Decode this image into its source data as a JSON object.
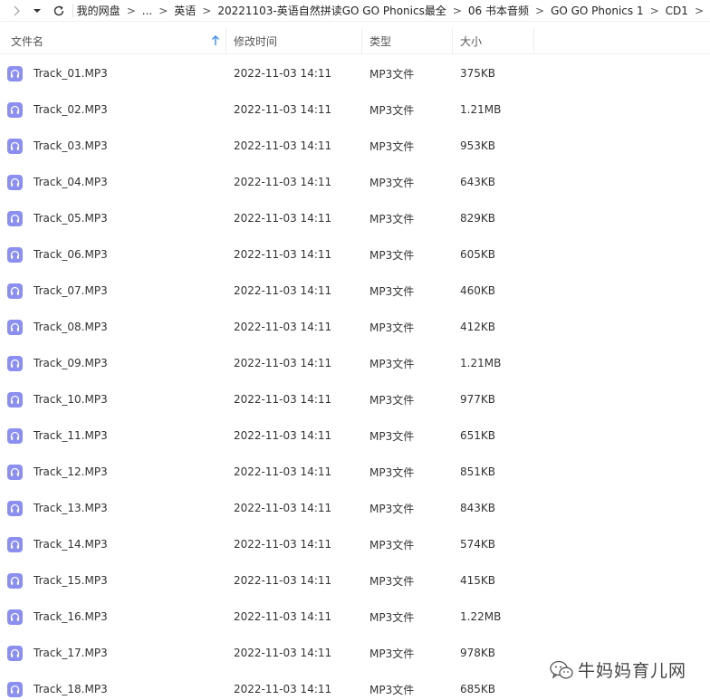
{
  "navbar": {
    "back_icon": "chevron-right-icon",
    "menu_icon": "chevron-down-icon",
    "refresh_icon": "refresh-icon",
    "crumbs": [
      "我的网盘",
      "...",
      "英语",
      "20221103-英语自然拼读GO GO Phonics最全",
      "06 书本音频",
      "GO GO Phonics 1",
      "CD1"
    ],
    "separator": ">"
  },
  "columns": {
    "name": "文件名",
    "date": "修改时间",
    "type": "类型",
    "size": "大小",
    "sort_icon": "arrow-up-icon"
  },
  "files": [
    {
      "name": "Track_01.MP3",
      "date": "2022-11-03 14:11",
      "type": "MP3文件",
      "size": "375KB"
    },
    {
      "name": "Track_02.MP3",
      "date": "2022-11-03 14:11",
      "type": "MP3文件",
      "size": "1.21MB"
    },
    {
      "name": "Track_03.MP3",
      "date": "2022-11-03 14:11",
      "type": "MP3文件",
      "size": "953KB"
    },
    {
      "name": "Track_04.MP3",
      "date": "2022-11-03 14:11",
      "type": "MP3文件",
      "size": "643KB"
    },
    {
      "name": "Track_05.MP3",
      "date": "2022-11-03 14:11",
      "type": "MP3文件",
      "size": "829KB"
    },
    {
      "name": "Track_06.MP3",
      "date": "2022-11-03 14:11",
      "type": "MP3文件",
      "size": "605KB"
    },
    {
      "name": "Track_07.MP3",
      "date": "2022-11-03 14:11",
      "type": "MP3文件",
      "size": "460KB"
    },
    {
      "name": "Track_08.MP3",
      "date": "2022-11-03 14:11",
      "type": "MP3文件",
      "size": "412KB"
    },
    {
      "name": "Track_09.MP3",
      "date": "2022-11-03 14:11",
      "type": "MP3文件",
      "size": "1.21MB"
    },
    {
      "name": "Track_10.MP3",
      "date": "2022-11-03 14:11",
      "type": "MP3文件",
      "size": "977KB"
    },
    {
      "name": "Track_11.MP3",
      "date": "2022-11-03 14:11",
      "type": "MP3文件",
      "size": "651KB"
    },
    {
      "name": "Track_12.MP3",
      "date": "2022-11-03 14:11",
      "type": "MP3文件",
      "size": "851KB"
    },
    {
      "name": "Track_13.MP3",
      "date": "2022-11-03 14:11",
      "type": "MP3文件",
      "size": "843KB"
    },
    {
      "name": "Track_14.MP3",
      "date": "2022-11-03 14:11",
      "type": "MP3文件",
      "size": "574KB"
    },
    {
      "name": "Track_15.MP3",
      "date": "2022-11-03 14:11",
      "type": "MP3文件",
      "size": "415KB"
    },
    {
      "name": "Track_16.MP3",
      "date": "2022-11-03 14:11",
      "type": "MP3文件",
      "size": "1.22MB"
    },
    {
      "name": "Track_17.MP3",
      "date": "2022-11-03 14:11",
      "type": "MP3文件",
      "size": "978KB"
    },
    {
      "name": "Track_18.MP3",
      "date": "2022-11-03 14:11",
      "type": "MP3文件",
      "size": "685KB"
    }
  ],
  "file_icon": "audio-file-icon",
  "watermark": {
    "icon": "wechat-icon",
    "text": "牛妈妈育儿网"
  },
  "colors": {
    "accent": "#3b8cf5",
    "file_icon_bg": "#8b8ff0"
  }
}
